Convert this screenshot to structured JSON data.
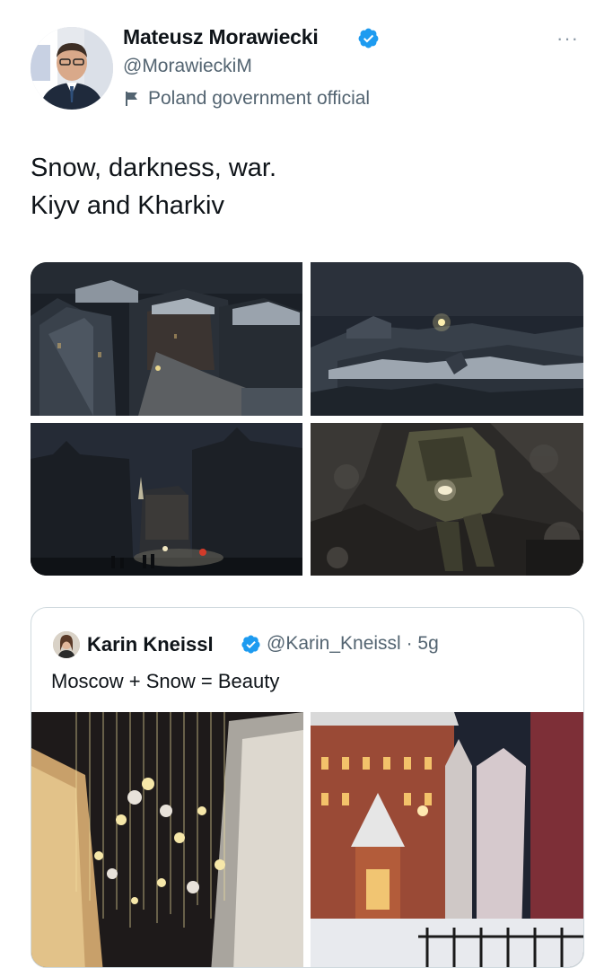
{
  "tweet": {
    "author_name": "Mateusz Morawiecki",
    "author_handle": "@MorawieckiM",
    "account_label": "Poland government official",
    "text_line1": "Snow, darkness, war.",
    "text_line2": "Kiyv and Kharkiv",
    "more_label": "···",
    "photos": [
      {
        "icon": "night-city-rooftops"
      },
      {
        "icon": "night-city-snow-panorama"
      },
      {
        "icon": "dark-street-silhouettes"
      },
      {
        "icon": "soldier-with-flashlight"
      }
    ]
  },
  "quoted_tweet": {
    "author_name": "Karin Kneissl",
    "author_handle": "@Karin_Kneissl",
    "separator": "·",
    "time": "5g",
    "text": "Moscow + Snow = Beauty",
    "photos": [
      {
        "icon": "moscow-street-lights"
      },
      {
        "icon": "moscow-red-building-snow"
      }
    ]
  },
  "colors": {
    "verified_blue": "#1d9bf0",
    "text_primary": "#0f1419",
    "text_secondary": "#536471",
    "border": "#cfd9de"
  }
}
